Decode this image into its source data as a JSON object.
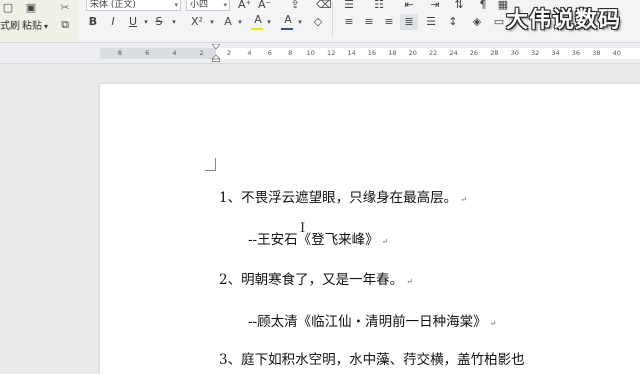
{
  "ribbon": {
    "format_painter_label": "式刷",
    "paste_label": "粘贴",
    "paste_dropdown": "▾",
    "font_name": "宋体 (正文)",
    "font_size": "小四",
    "icons": {
      "bold": "B",
      "italic": "I",
      "underline": "U",
      "strikethrough": "S",
      "superscript": "X²",
      "text_effect": "A",
      "highlight": "A",
      "font_color": "A",
      "clear_format": "◇"
    },
    "colors": {
      "highlight": "#f5e400",
      "font_color": "#d0021b",
      "accent": "#2b579a"
    }
  },
  "ruler": {
    "ticks_left": [
      "8",
      "6",
      "4",
      "2"
    ],
    "ticks_right": [
      "2",
      "4",
      "6",
      "8",
      "10",
      "12",
      "14",
      "16",
      "18",
      "20",
      "22",
      "24",
      "26",
      "28",
      "30",
      "32",
      "34",
      "36",
      "38",
      "40"
    ]
  },
  "document": {
    "lines": [
      {
        "text": "1、不畏浮云遮望眼，只缘身在最高层。",
        "mark": "↵"
      },
      {
        "text": "--王安石《登飞来峰》",
        "mark": "↵"
      },
      {
        "text": "2、明朝寒食了，又是一年春。",
        "mark": "↵"
      },
      {
        "text": "--顾太清《临江仙・清明前一日种海棠》",
        "mark": "↵"
      },
      {
        "text": "3、庭下如积水空明，水中藻、荇交横，盖竹柏影也",
        "mark": ""
      }
    ]
  },
  "watermark": "大伟说数码"
}
